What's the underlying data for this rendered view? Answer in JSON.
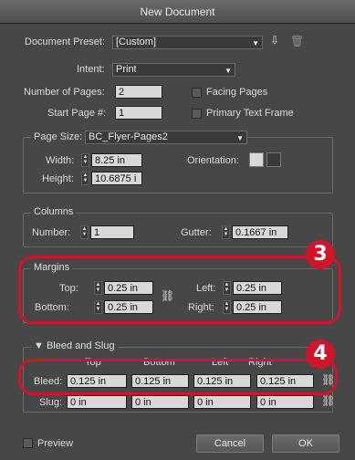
{
  "window": {
    "title": "New Document"
  },
  "preset": {
    "label": "Document Preset:",
    "value": "[Custom]"
  },
  "intent": {
    "label": "Intent:",
    "value": "Print"
  },
  "pages": {
    "num_label": "Number of Pages:",
    "num_value": "2",
    "start_label": "Start Page #:",
    "start_value": "1",
    "facing_label": "Facing Pages",
    "primary_label": "Primary Text Frame"
  },
  "page_size": {
    "label": "Page Size:",
    "value": "BC_Flyer-Pages2",
    "width_label": "Width:",
    "width_value": "8.25 in",
    "height_label": "Height:",
    "height_value": "10.6875 i",
    "orientation_label": "Orientation:"
  },
  "columns": {
    "title": "Columns",
    "number_label": "Number:",
    "number_value": "1",
    "gutter_label": "Gutter:",
    "gutter_value": "0.1667 in"
  },
  "margins": {
    "title": "Margins",
    "top_label": "Top:",
    "top_value": "0.25 in",
    "bottom_label": "Bottom:",
    "bottom_value": "0.25 in",
    "left_label": "Left:",
    "left_value": "0.25 in",
    "right_label": "Right:",
    "right_value": "0.25 in"
  },
  "bleed": {
    "title": "Bleed and Slug",
    "col_top": "Top",
    "col_bottom": "Bottom",
    "col_left": "Left",
    "col_right": "Right",
    "bleed_label": "Bleed:",
    "bleed_top": "0.125 in",
    "bleed_bottom": "0.125 in",
    "bleed_left": "0.125 in",
    "bleed_right": "0.125 in",
    "slug_label": "Slug:",
    "slug_top": "0 in",
    "slug_bottom": "0 in",
    "slug_left": "0 in",
    "slug_right": "0 in"
  },
  "badges": {
    "margins": "3",
    "bleed": "4"
  },
  "footer": {
    "preview_label": "Preview",
    "cancel_label": "Cancel",
    "ok_label": "OK"
  },
  "colors": {
    "highlight": "#d0152a",
    "dialog_bg": "#474747"
  },
  "icons": {
    "save_preset": "save-preset-icon",
    "delete_preset": "trash-icon",
    "link": "chain-link-icon",
    "portrait": "portrait-icon",
    "landscape": "landscape-icon"
  }
}
